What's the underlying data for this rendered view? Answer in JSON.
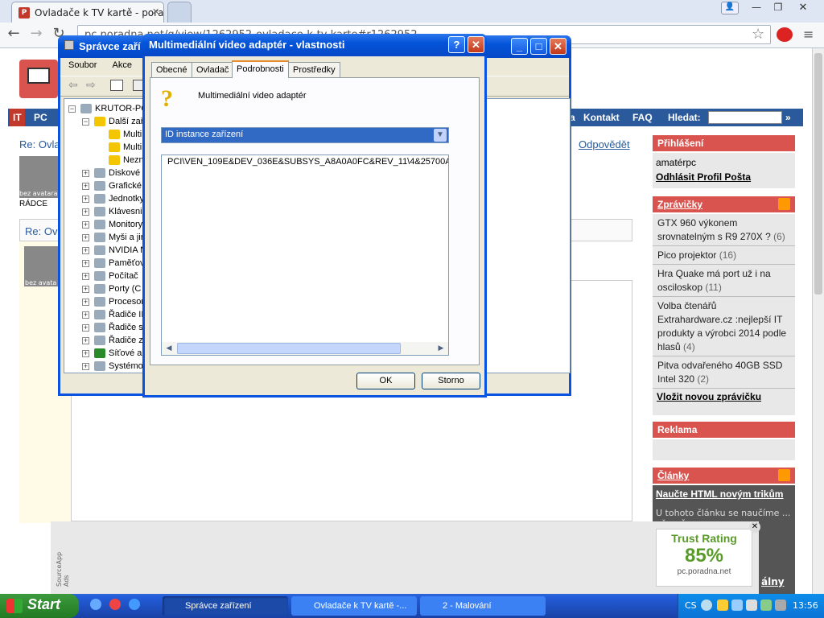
{
  "browser": {
    "tab_active": "Ovladače k TV kartě - poradn",
    "url": "pc.poradna.net/q/view/1262952-ovladace-k-tv-karte#r1262952",
    "nav": {
      "back": "←",
      "forward": "→",
      "reload": "↻"
    },
    "icons": {
      "star": "star-icon",
      "menu": "menu-icon"
    }
  },
  "page": {
    "nav_items": [
      "IT",
      "PC",
      "a",
      "Kontakt",
      "FAQ",
      "Hledat:"
    ],
    "nav_search_button": "»",
    "reply_link_left": "Re: Ovla",
    "reply_link_right": "Odpovědět",
    "avatar_label": "bez avatara",
    "avatar_label2": "bez avata",
    "radce_label": "RÁDCE",
    "reply_box_title": "Re: Ov",
    "login": {
      "header": "Přihlášení",
      "user": "amatérpc",
      "links": [
        "Odhlásit",
        "Profil",
        "Pošta"
      ]
    },
    "news": {
      "header": "Zprávičky",
      "items": [
        {
          "title": "GTX 960 výkonem srovnatelným s R9 270X ?",
          "count": "(6)"
        },
        {
          "title": "Pico projektor",
          "count": "(16)"
        },
        {
          "title": "Hra Quake má port už i na osciloskop",
          "count": "(11)"
        },
        {
          "title": "Volba čtenářů Extrahardware.cz :nejlepší IT produkty a výrobci 2014 podle hlasů",
          "count": "(4)"
        },
        {
          "title": "Pitva odvařeného 40GB SSD Intel 320",
          "count": "(2)"
        }
      ],
      "add_link": "Vložit novou zprávičku"
    },
    "ads_header": "Reklama",
    "articles": {
      "header": "Články",
      "first_title": "Naučte HTML novým trikům",
      "snippet": "U tohoto článku se naučíme ... přesně ... ",
      "partial_link": "álny"
    },
    "trust": {
      "label": "Trust Rating",
      "value": "85%",
      "site": "pc.poradna.net"
    },
    "sourceapp": "SourceApp Ads"
  },
  "devmgr": {
    "title": "Správce zaří",
    "menu": [
      "Soubor",
      "Akce",
      "Z"
    ],
    "root": "KRUTOR-PC",
    "tree": [
      {
        "label": "Další zař",
        "expanded": true
      },
      {
        "label": "Multi",
        "child": true
      },
      {
        "label": "Multi",
        "child": true
      },
      {
        "label": "Nezn",
        "child": true
      },
      {
        "label": "Diskové"
      },
      {
        "label": "Grafické"
      },
      {
        "label": "Jednotky"
      },
      {
        "label": "Klávesnic"
      },
      {
        "label": "Monitory"
      },
      {
        "label": "Myši a jir"
      },
      {
        "label": "NVIDIA N"
      },
      {
        "label": "Paměťov"
      },
      {
        "label": "Počítač"
      },
      {
        "label": "Porty (C"
      },
      {
        "label": "Procesor"
      },
      {
        "label": "Řadiče II"
      },
      {
        "label": "Řadiče s"
      },
      {
        "label": "Řadiče z"
      },
      {
        "label": "Síťové a"
      },
      {
        "label": "Systémo"
      }
    ]
  },
  "props": {
    "title": "Multimediální video adaptér - vlastnosti",
    "help": "?",
    "close": "✕",
    "tabs": [
      "Obecné",
      "Ovladač",
      "Podrobnosti",
      "Prostředky"
    ],
    "active_tab": "Podrobnosti",
    "device_name": "Multimediální video adaptér",
    "property_selected": "ID instance zařízení",
    "value": "PCI\\VEN_109E&DEV_036E&SUBSYS_A8A0A0FC&REV_11\\4&25700A2(",
    "ok": "OK",
    "cancel": "Storno"
  },
  "taskbar": {
    "start": "Start",
    "tasks": [
      "Správce zařízení",
      "Ovladače k TV kartě -...",
      "2 - Malování"
    ],
    "lang": "CS",
    "clock": "13:56"
  }
}
